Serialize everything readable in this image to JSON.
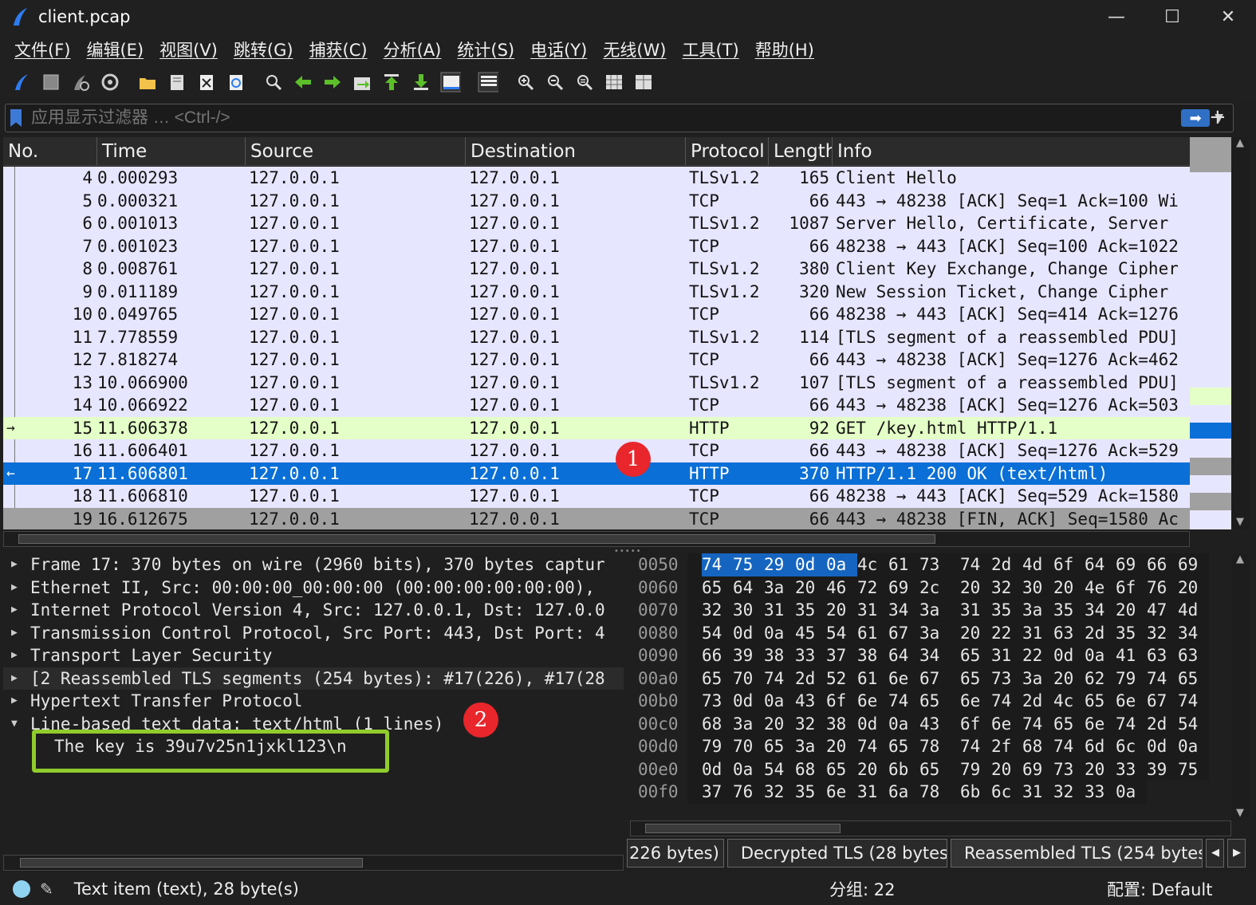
{
  "window": {
    "title": "client.pcap"
  },
  "menu": [
    "文件(F)",
    "编辑(E)",
    "视图(V)",
    "跳转(G)",
    "捕获(C)",
    "分析(A)",
    "统计(S)",
    "电话(Y)",
    "无线(W)",
    "工具(T)",
    "帮助(H)"
  ],
  "toolbar": [
    "shark-fin-icon",
    "stop-icon",
    "restart-icon",
    "options-gear-icon",
    "open-folder-icon",
    "save-file-icon",
    "close-file-icon",
    "reload-icon",
    "find-icon",
    "back-arrow-icon",
    "forward-arrow-icon",
    "go-to-packet-icon",
    "first-packet-icon",
    "last-packet-icon",
    "autoscroll-icon",
    "colorize-icon",
    "zoom-in-icon",
    "zoom-out-icon",
    "zoom-normal-icon",
    "resize-columns-icon",
    "column-prefs-icon"
  ],
  "filter": {
    "placeholder": "应用显示过滤器 … <Ctrl-/>",
    "apply": "➡"
  },
  "columns": [
    "No.",
    "Time",
    "Source",
    "Destination",
    "Protocol",
    "Length",
    "Info"
  ],
  "packets": [
    {
      "no": "4",
      "time": "0.000293",
      "src": "127.0.0.1",
      "dst": "127.0.0.1",
      "proto": "TLSv1.2",
      "len": "165",
      "info": "Client Hello",
      "style": "normal",
      "mark": ""
    },
    {
      "no": "5",
      "time": "0.000321",
      "src": "127.0.0.1",
      "dst": "127.0.0.1",
      "proto": "TCP",
      "len": "66",
      "info": "443 → 48238 [ACK] Seq=1 Ack=100 Wi",
      "style": "normal",
      "mark": ""
    },
    {
      "no": "6",
      "time": "0.001013",
      "src": "127.0.0.1",
      "dst": "127.0.0.1",
      "proto": "TLSv1.2",
      "len": "1087",
      "info": "Server Hello, Certificate, Server",
      "style": "normal",
      "mark": ""
    },
    {
      "no": "7",
      "time": "0.001023",
      "src": "127.0.0.1",
      "dst": "127.0.0.1",
      "proto": "TCP",
      "len": "66",
      "info": "48238 → 443 [ACK] Seq=100 Ack=1022",
      "style": "normal",
      "mark": ""
    },
    {
      "no": "8",
      "time": "0.008761",
      "src": "127.0.0.1",
      "dst": "127.0.0.1",
      "proto": "TLSv1.2",
      "len": "380",
      "info": "Client Key Exchange, Change Cipher",
      "style": "normal",
      "mark": ""
    },
    {
      "no": "9",
      "time": "0.011189",
      "src": "127.0.0.1",
      "dst": "127.0.0.1",
      "proto": "TLSv1.2",
      "len": "320",
      "info": "New Session Ticket, Change Cipher",
      "style": "normal",
      "mark": ""
    },
    {
      "no": "10",
      "time": "0.049765",
      "src": "127.0.0.1",
      "dst": "127.0.0.1",
      "proto": "TCP",
      "len": "66",
      "info": "48238 → 443 [ACK] Seq=414 Ack=1276",
      "style": "normal",
      "mark": ""
    },
    {
      "no": "11",
      "time": "7.778559",
      "src": "127.0.0.1",
      "dst": "127.0.0.1",
      "proto": "TLSv1.2",
      "len": "114",
      "info": "[TLS segment of a reassembled PDU]",
      "style": "normal",
      "mark": ""
    },
    {
      "no": "12",
      "time": "7.818274",
      "src": "127.0.0.1",
      "dst": "127.0.0.1",
      "proto": "TCP",
      "len": "66",
      "info": "443 → 48238 [ACK] Seq=1276 Ack=462",
      "style": "normal",
      "mark": ""
    },
    {
      "no": "13",
      "time": "10.066900",
      "src": "127.0.0.1",
      "dst": "127.0.0.1",
      "proto": "TLSv1.2",
      "len": "107",
      "info": "[TLS segment of a reassembled PDU]",
      "style": "normal",
      "mark": ""
    },
    {
      "no": "14",
      "time": "10.066922",
      "src": "127.0.0.1",
      "dst": "127.0.0.1",
      "proto": "TCP",
      "len": "66",
      "info": "443 → 48238 [ACK] Seq=1276 Ack=503",
      "style": "normal",
      "mark": ""
    },
    {
      "no": "15",
      "time": "11.606378",
      "src": "127.0.0.1",
      "dst": "127.0.0.1",
      "proto": "HTTP",
      "len": "92",
      "info": "GET /key.html HTTP/1.1",
      "style": "http",
      "mark": "→"
    },
    {
      "no": "16",
      "time": "11.606401",
      "src": "127.0.0.1",
      "dst": "127.0.0.1",
      "proto": "TCP",
      "len": "66",
      "info": "443 → 48238 [ACK] Seq=1276 Ack=529",
      "style": "normal",
      "mark": ""
    },
    {
      "no": "17",
      "time": "11.606801",
      "src": "127.0.0.1",
      "dst": "127.0.0.1",
      "proto": "HTTP",
      "len": "370",
      "info": "HTTP/1.1 200 OK  (text/html)",
      "style": "sel",
      "mark": "←"
    },
    {
      "no": "18",
      "time": "11.606810",
      "src": "127.0.0.1",
      "dst": "127.0.0.1",
      "proto": "TCP",
      "len": "66",
      "info": "48238 → 443 [ACK] Seq=529 Ack=1580",
      "style": "normal",
      "mark": ""
    },
    {
      "no": "19",
      "time": "16.612675",
      "src": "127.0.0.1",
      "dst": "127.0.0.1",
      "proto": "TCP",
      "len": "66",
      "info": "443 → 48238 [FIN, ACK] Seq=1580 Ac",
      "style": "fin",
      "mark": ""
    }
  ],
  "details": [
    {
      "text": "Frame 17: 370 bytes on wire (2960 bits), 370 bytes captur",
      "expanded": false
    },
    {
      "text": "Ethernet II, Src: 00:00:00_00:00:00 (00:00:00:00:00:00),",
      "expanded": false
    },
    {
      "text": "Internet Protocol Version 4, Src: 127.0.0.1, Dst: 127.0.0",
      "expanded": false
    },
    {
      "text": "Transmission Control Protocol, Src Port: 443, Dst Port: 4",
      "expanded": false
    },
    {
      "text": "Transport Layer Security",
      "expanded": false
    },
    {
      "text": "[2 Reassembled TLS segments (254 bytes): #17(226), #17(28",
      "expanded": false
    },
    {
      "text": "Hypertext Transfer Protocol",
      "expanded": false
    },
    {
      "text": "Line-based text data: text/html (1 lines)",
      "expanded": true
    }
  ],
  "key_line": "The key is 39u7v25n1jxkl123\\n",
  "hex": [
    {
      "off": "0050",
      "bytes": [
        "74",
        "75",
        "29",
        "0d",
        "0a",
        "4c",
        "61",
        "73",
        "74",
        "2d",
        "4d",
        "6f",
        "64",
        "69",
        "66",
        "69"
      ]
    },
    {
      "off": "0060",
      "bytes": [
        "65",
        "64",
        "3a",
        "20",
        "46",
        "72",
        "69",
        "2c",
        "20",
        "32",
        "30",
        "20",
        "4e",
        "6f",
        "76",
        "20"
      ]
    },
    {
      "off": "0070",
      "bytes": [
        "32",
        "30",
        "31",
        "35",
        "20",
        "31",
        "34",
        "3a",
        "31",
        "35",
        "3a",
        "35",
        "34",
        "20",
        "47",
        "4d"
      ]
    },
    {
      "off": "0080",
      "bytes": [
        "54",
        "0d",
        "0a",
        "45",
        "54",
        "61",
        "67",
        "3a",
        "20",
        "22",
        "31",
        "63",
        "2d",
        "35",
        "32",
        "34"
      ]
    },
    {
      "off": "0090",
      "bytes": [
        "66",
        "39",
        "38",
        "33",
        "37",
        "38",
        "64",
        "34",
        "65",
        "31",
        "22",
        "0d",
        "0a",
        "41",
        "63",
        "63"
      ]
    },
    {
      "off": "00a0",
      "bytes": [
        "65",
        "70",
        "74",
        "2d",
        "52",
        "61",
        "6e",
        "67",
        "65",
        "73",
        "3a",
        "20",
        "62",
        "79",
        "74",
        "65"
      ]
    },
    {
      "off": "00b0",
      "bytes": [
        "73",
        "0d",
        "0a",
        "43",
        "6f",
        "6e",
        "74",
        "65",
        "6e",
        "74",
        "2d",
        "4c",
        "65",
        "6e",
        "67",
        "74"
      ]
    },
    {
      "off": "00c0",
      "bytes": [
        "68",
        "3a",
        "20",
        "32",
        "38",
        "0d",
        "0a",
        "43",
        "6f",
        "6e",
        "74",
        "65",
        "6e",
        "74",
        "2d",
        "54"
      ]
    },
    {
      "off": "00d0",
      "bytes": [
        "79",
        "70",
        "65",
        "3a",
        "20",
        "74",
        "65",
        "78",
        "74",
        "2f",
        "68",
        "74",
        "6d",
        "6c",
        "0d",
        "0a"
      ]
    },
    {
      "off": "00e0",
      "bytes": [
        "0d",
        "0a",
        "54",
        "68",
        "65",
        "20",
        "6b",
        "65",
        "79",
        "20",
        "69",
        "73",
        "20",
        "33",
        "39",
        "75"
      ]
    },
    {
      "off": "00f0",
      "bytes": [
        "37",
        "76",
        "32",
        "35",
        "6e",
        "31",
        "6a",
        "78",
        "6b",
        "6c",
        "31",
        "32",
        "33",
        "0a"
      ]
    }
  ],
  "byte_tabs": [
    "226 bytes)",
    "Decrypted TLS (28 bytes)",
    "Reassembled TLS (254 bytes)"
  ],
  "status": {
    "item": "Text item (text), 28 byte(s)",
    "packets": "分组: 22",
    "profile": "配置: Default"
  },
  "annotations": [
    "1",
    "2"
  ],
  "colors": {
    "highlight_box": "#8fcc2c",
    "badge": "#e8262b",
    "selected_row": "#0a6fd6",
    "http_row": "#e4ffc7",
    "tcp_row": "#e7e6ff"
  }
}
